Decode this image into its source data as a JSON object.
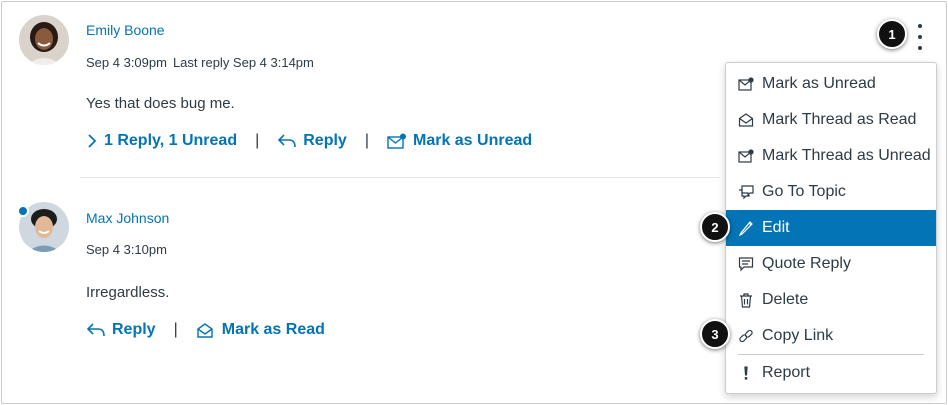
{
  "posts": [
    {
      "author": "Emily Boone",
      "posted": "Sep 4 3:09pm",
      "last_reply": "Last reply Sep 4 3:14pm",
      "body": "Yes that does bug me.",
      "actions": {
        "replies": "1 Reply, 1 Unread",
        "reply": "Reply",
        "mark": "Mark as Unread"
      }
    },
    {
      "author": "Max Johnson",
      "posted": "Sep 4 3:10pm",
      "body": "Irregardless.",
      "actions": {
        "reply": "Reply",
        "mark": "Mark as Read"
      }
    }
  ],
  "separator": "|",
  "menu": {
    "items": [
      {
        "label": "Mark as Unread",
        "icon": "envelope-unread-icon"
      },
      {
        "label": "Mark Thread as Read",
        "icon": "envelope-open-icon"
      },
      {
        "label": "Mark Thread as Unread",
        "icon": "envelope-unread-icon"
      },
      {
        "label": "Go To Topic",
        "icon": "discussion-icon"
      },
      {
        "label": "Edit",
        "icon": "pencil-icon",
        "selected": true
      },
      {
        "label": "Quote Reply",
        "icon": "quote-icon"
      },
      {
        "label": "Delete",
        "icon": "trash-icon"
      },
      {
        "label": "Copy Link",
        "icon": "link-icon"
      },
      {
        "label": "Report",
        "icon": "exclamation-icon"
      }
    ]
  },
  "callouts": [
    "1",
    "2",
    "3"
  ],
  "colors": {
    "link": "#0374b5",
    "text": "#2d3b45",
    "menu_selected": "#0374b5",
    "unread_dot": "#0374b5",
    "callout": "#111111"
  }
}
